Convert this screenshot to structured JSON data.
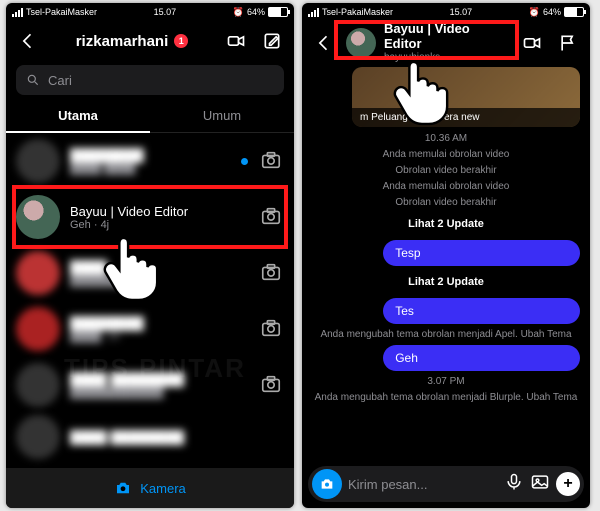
{
  "status": {
    "carrier": "Tsel-PakaiMasker",
    "time": "15.07",
    "battery": "64%"
  },
  "left": {
    "title": "rizkamarhani",
    "badge": "1",
    "search_placeholder": "Cari",
    "tabs": {
      "primary": "Utama",
      "general": "Umum"
    },
    "highlight_row": {
      "name": "Bayuu | Video Editor",
      "sub": "Geh · 4j"
    },
    "footer": "Kamera"
  },
  "right": {
    "name": "Bayuu | Video Editor",
    "username": "bayuubionks",
    "story_caption": "m Peluang baru di era new",
    "time1": "10.36 AM",
    "sys1": "Anda memulai obrolan video",
    "sys2": "Obrolan video berakhir",
    "sys3": "Anda memulai obrolan video",
    "sys4": "Obrolan video berakhir",
    "update": "Lihat 2 Update",
    "msg1": "Tesp",
    "msg2": "Tes",
    "sys_theme1": "Anda mengubah tema obrolan menjadi Apel. Ubah Tema",
    "msg3": "Geh",
    "time2": "3.07 PM",
    "sys_theme2": "Anda mengubah tema obrolan menjadi Blurple. Ubah Tema",
    "composer_placeholder": "Kirim pesan..."
  },
  "watermark": "TIPS PINTAR"
}
